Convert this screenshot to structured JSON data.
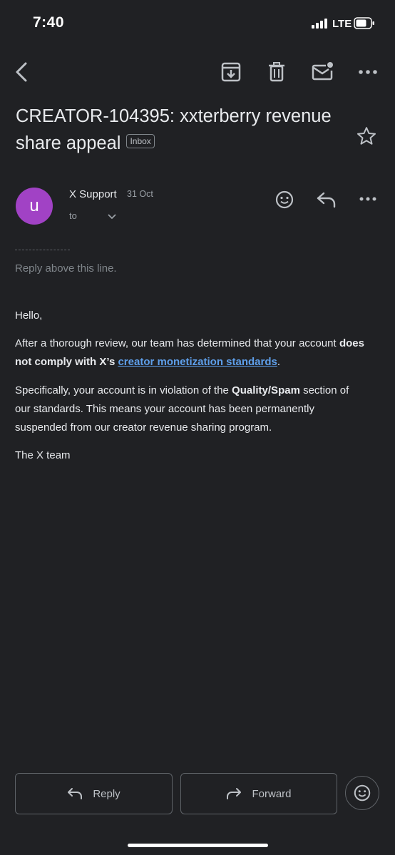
{
  "status_bar": {
    "time": "7:40",
    "network": "LTE"
  },
  "email": {
    "subject": "CREATOR-104395: xxterberry revenue share appeal",
    "label": "Inbox",
    "sender": {
      "avatar_letter": "u",
      "avatar_color": "#a142c5",
      "name": "X Support",
      "date": "31 Oct",
      "to_label": "to"
    },
    "reply_divider": "___________",
    "reply_above": "Reply above this line.",
    "body": {
      "greeting": "Hello,",
      "p2_part1": "After a thorough review, our team has determined that your account ",
      "p2_bold": "does not comply with X’s",
      "p2_space": " ",
      "p2_link": "creator monetization standards",
      "p2_end": ".",
      "p3_part1": "Specifically, your account is in violation of the ",
      "p3_bold": "Quality/Spam",
      "p3_part2": " section of our standards. This means your account has been permanently suspended from our creator revenue sharing program.",
      "signoff": "The X team"
    }
  },
  "actions": {
    "reply_label": "Reply",
    "forward_label": "Forward"
  },
  "colors": {
    "background": "#202124",
    "link": "#5e9fea",
    "avatar": "#a142c5"
  },
  "icons": [
    "back-arrow-icon",
    "archive-icon",
    "delete-icon",
    "mark-unread-icon",
    "more-icon",
    "star-icon",
    "emoji-icon",
    "reply-icon",
    "forward-icon"
  ]
}
